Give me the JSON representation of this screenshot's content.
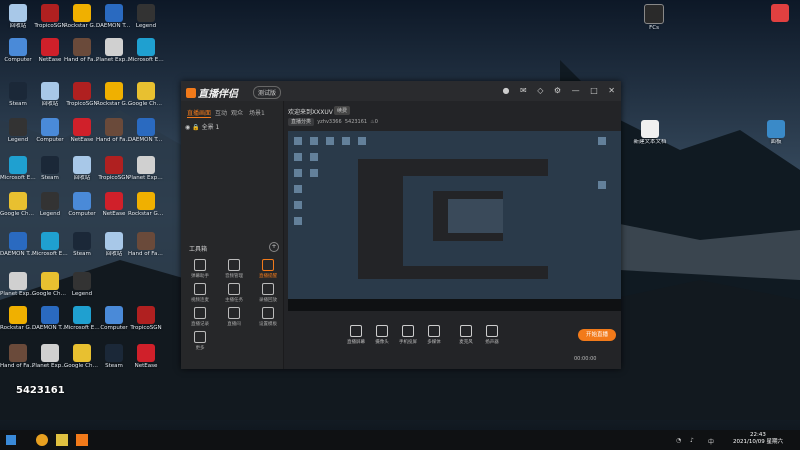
{
  "desktop": {
    "icons_left": [
      {
        "label": "回收站",
        "color": "#a8c8e8"
      },
      {
        "label": "Computer",
        "color": "#4a8ad8"
      },
      {
        "label": "Steam",
        "color": "#1b2838"
      },
      {
        "label": "Legend",
        "color": "#333333"
      },
      {
        "label": "Microsoft Edge",
        "color": "#1fa0d0"
      },
      {
        "label": "Google Chrome",
        "color": "#e8c030"
      },
      {
        "label": "DAEMON Tools Lite",
        "color": "#2a6ac0"
      },
      {
        "label": "Planet Explorers",
        "color": "#d0d0d0"
      },
      {
        "label": "Rockstar Games",
        "color": "#f0b000"
      },
      {
        "label": "Hand of Fate 2",
        "color": "#6a4a3a"
      },
      {
        "label": "TropicoSGN",
        "color": "#b02020"
      },
      {
        "label": "NetEase",
        "color": "#d0202a"
      }
    ],
    "icons_right": [
      {
        "label": "FCs",
        "color": "#2a2a2a"
      },
      {
        "label": "新建文本文档",
        "color": "#f0f0f0"
      },
      {
        "label": "面板",
        "color": "#3a8ac8"
      }
    ],
    "watermark_text": "5423161"
  },
  "window": {
    "title": "直播伴侣",
    "version_badge": "测试版",
    "sidebar": {
      "tabs": [
        "直播画面",
        "互动",
        "观众",
        "场景1"
      ],
      "scene_label": "全景 1",
      "tools_title": "工具箱",
      "tools": [
        "弹幕助手",
        "音频管理",
        "直播提醒",
        "视频连麦",
        "主播任务",
        "录播回放",
        "直播记录",
        "直播间",
        "设置模板",
        "更多"
      ]
    },
    "main": {
      "welcome": "欢迎来到XXXUV",
      "renew_label": "续费",
      "category": "直播分类",
      "room_user": "yzhv3366",
      "room_id": "5423161",
      "heat": "0"
    },
    "bottom_bar": {
      "buttons": [
        "直播屏幕",
        "摄像头",
        "手机投屏",
        "多媒体",
        "麦克风",
        "扬声器"
      ],
      "start_button": "开始直播",
      "timer": "00:00:00"
    }
  },
  "taskbar": {
    "time": "22:43",
    "date": "2021/10/09 星期六",
    "lang": "中"
  }
}
